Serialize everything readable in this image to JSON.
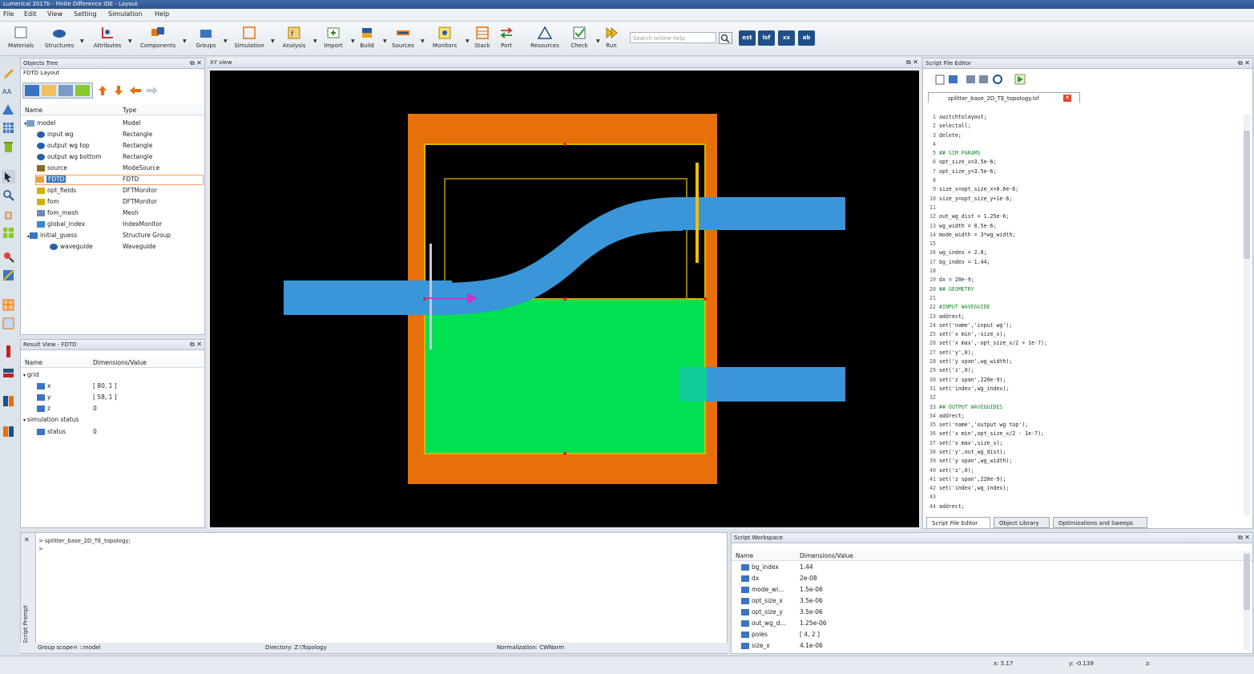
{
  "window": {
    "title": "Lumerical 2017b - Finite Difference IDE - Layout"
  },
  "menu": [
    "File",
    "Edit",
    "View",
    "Setting",
    "Simulation",
    "Help"
  ],
  "toolbar": {
    "buttons": [
      "Materials",
      "Structures",
      "Attributes",
      "Components",
      "Groups",
      "Simulation",
      "Analysis",
      "Import",
      "Build",
      "Sources",
      "Monitors",
      "Stack",
      "Port",
      "Resources",
      "Check",
      "Run"
    ],
    "search_placeholder": "Search online help",
    "blocks": [
      "est",
      "lsf",
      "xx",
      "ab"
    ]
  },
  "objects_tree": {
    "title": "Objects Tree",
    "subtitle": "FDTD Layout",
    "col_name": "Name",
    "col_type": "Type",
    "rows": [
      {
        "name": "model",
        "type": "Model"
      },
      {
        "name": "input wg",
        "type": "Rectangle"
      },
      {
        "name": "output wg top",
        "type": "Rectangle"
      },
      {
        "name": "output wg bottom",
        "type": "Rectangle"
      },
      {
        "name": "source",
        "type": "ModeSource"
      },
      {
        "name": "FDTD",
        "type": "FDTD"
      },
      {
        "name": "opt_fields",
        "type": "DFTMonitor"
      },
      {
        "name": "fom",
        "type": "DFTMonitor"
      },
      {
        "name": "fom_mesh",
        "type": "Mesh"
      },
      {
        "name": "global_index",
        "type": "IndexMonitor"
      },
      {
        "name": "initial_guess",
        "type": "Structure Group"
      },
      {
        "name": "waveguide",
        "type": "Waveguide"
      }
    ]
  },
  "result_view": {
    "title": "Result View - FDTD",
    "col_name": "Name",
    "col_value": "Dimensions/Value",
    "rows": [
      {
        "name": "grid",
        "value": ""
      },
      {
        "name": "x",
        "value": "[ 80, 1 ]"
      },
      {
        "name": "y",
        "value": "[ 58, 1 ]"
      },
      {
        "name": "z",
        "value": "0"
      },
      {
        "name": "simulation status",
        "value": ""
      },
      {
        "name": "status",
        "value": "0"
      }
    ]
  },
  "xy_view": {
    "title": "XY view"
  },
  "script_editor": {
    "title": "Script File Editor",
    "file_tab": "splitter_base_2D_TE_topology.lsf",
    "lines": [
      "switchtolayout;",
      "selectall;",
      "delete;",
      "",
      "## SIM PARAMS",
      "opt_size_x=3.5e-6;",
      "opt_size_y=3.5e-6;",
      "",
      "size_x=opt_size_x+0.6e-6;",
      "size_y=opt_size_y+1e-6;",
      "",
      "out_wg_dist = 1.25e-6;",
      "wg_width = 0.5e-6;",
      "mode_width = 3*wg_width;",
      "",
      "wg_index = 2.8;",
      "bg_index = 1.44;",
      "",
      "dx = 20e-9;",
      "## GEOMETRY",
      "",
      "#INPUT WAVEGUIDE",
      "addrect;",
      "set('name','input wg');",
      "set('x min',-size_x);",
      "set('x max',-opt_size_x/2 + 1e-7);",
      "set('y',0);",
      "set('y span',wg_width);",
      "set('z',0);",
      "set('z span',220e-9);",
      "set('index',wg_index);",
      "",
      "## OUTPUT WAVEGUIDES",
      "addrect;",
      "set('name','output wg top');",
      "set('x min',opt_size_x/2 - 1e-7);",
      "set('x max',size_x);",
      "set('y',out_wg_dist);",
      "set('y span',wg_width);",
      "set('z',0);",
      "set('z span',220e-9);",
      "set('index',wg_index);",
      "",
      "addrect;"
    ],
    "bottom_tabs": [
      "Script File Editor",
      "Object Library",
      "Optimizations and Sweeps"
    ]
  },
  "script_prompt": {
    "label": "Script Prompt",
    "lines": [
      "> splitter_base_2D_TE_topology;",
      ">"
    ],
    "status_scope": "Group scope= ::model",
    "status_dir": "Directory: Z:\\Topology",
    "status_norm": "Normalization: CWNorm"
  },
  "script_workspace": {
    "title": "Script Workspace",
    "col_name": "Name",
    "col_value": "Dimensions/Value",
    "rows": [
      {
        "name": "bg_index",
        "value": "1.44"
      },
      {
        "name": "dx",
        "value": "2e-08"
      },
      {
        "name": "mode_wi...",
        "value": "1.5e-06"
      },
      {
        "name": "opt_size_x",
        "value": "3.5e-06"
      },
      {
        "name": "opt_size_y",
        "value": "3.5e-06"
      },
      {
        "name": "out_wg_d...",
        "value": "1.25e-06"
      },
      {
        "name": "poles",
        "value": "[ 4, 2 ]"
      },
      {
        "name": "size_x",
        "value": "4.1e-06"
      }
    ]
  },
  "statusbar": {
    "x": "x: 5.17",
    "y": "y: -0.139",
    "z": "z:"
  },
  "colors": {
    "orange": "#e8700a",
    "green": "#00e050",
    "blue": "#3a96d8",
    "yellow": "#d8b800",
    "canvas": "#000000"
  }
}
